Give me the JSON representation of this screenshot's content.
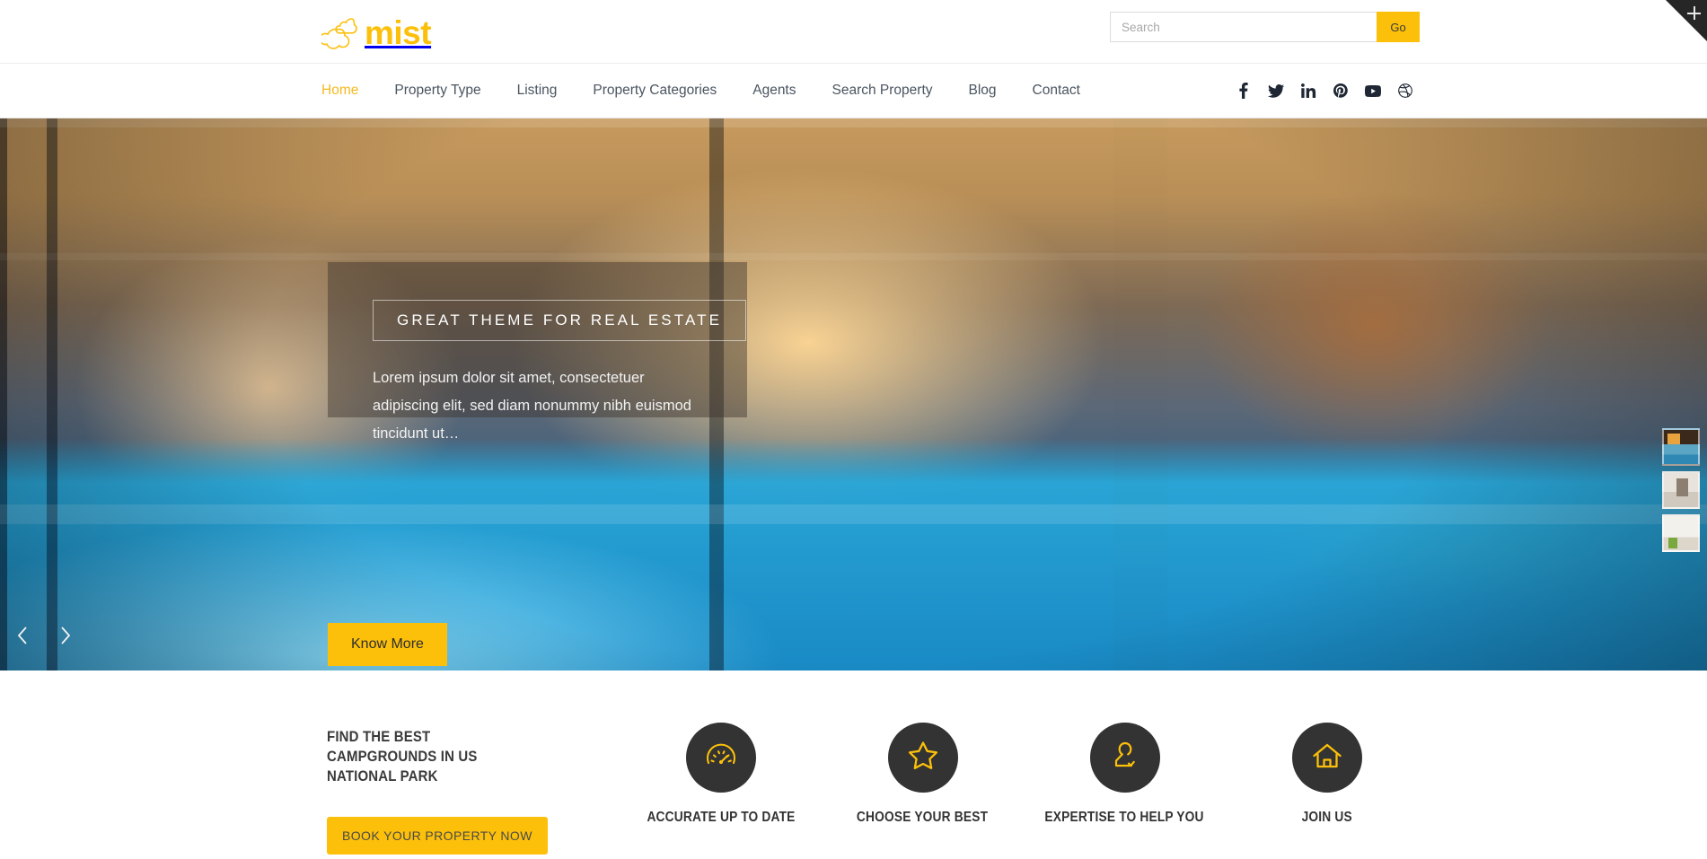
{
  "brand": {
    "name": "mist",
    "color": "#fcc00a",
    "logo_icon": "cloud-icon"
  },
  "search": {
    "placeholder": "Search",
    "value": "",
    "button_label": "Go"
  },
  "corner": {
    "icon": "plus-icon"
  },
  "nav": {
    "items": [
      {
        "label": "Home",
        "active": true
      },
      {
        "label": "Property Type",
        "active": false
      },
      {
        "label": "Listing",
        "active": false
      },
      {
        "label": "Property Categories",
        "active": false
      },
      {
        "label": "Agents",
        "active": false
      },
      {
        "label": "Search Property",
        "active": false
      },
      {
        "label": "Blog",
        "active": false
      },
      {
        "label": "Contact",
        "active": false
      }
    ],
    "active_color": "#f5b921",
    "link_color": "#4a5560",
    "social": [
      {
        "name": "facebook-icon"
      },
      {
        "name": "twitter-icon"
      },
      {
        "name": "linkedin-icon"
      },
      {
        "name": "pinterest-icon"
      },
      {
        "name": "youtube-icon"
      },
      {
        "name": "dribbble-icon"
      }
    ]
  },
  "hero": {
    "caption_title": "GREAT THEME FOR REAL ESTATE",
    "caption_text": "Lorem ipsum dolor sit amet, consectetuer adipiscing elit, sed diam nonummy nibh euismod tincidunt ut…",
    "cta_label": "Know More",
    "prev_icon": "chevron-left-icon",
    "next_icon": "chevron-right-icon",
    "thumbnails": [
      {
        "name": "thumbnail-pool-villa"
      },
      {
        "name": "thumbnail-bathroom"
      },
      {
        "name": "thumbnail-kids-room"
      }
    ]
  },
  "features": {
    "promo_title": "FIND THE BEST CAMPGROUNDS IN US NATIONAL PARK",
    "promo_button": "BOOK YOUR PROPERTY NOW",
    "items": [
      {
        "label": "ACCURATE UP TO DATE",
        "icon": "speedometer-icon"
      },
      {
        "label": "CHOOSE YOUR BEST",
        "icon": "star-icon"
      },
      {
        "label": "EXPERTISE TO HELP YOU",
        "icon": "user-check-icon"
      },
      {
        "label": "JOIN US",
        "icon": "home-icon"
      }
    ],
    "icon_color": "#fcc00a",
    "circle_color": "#333333"
  }
}
